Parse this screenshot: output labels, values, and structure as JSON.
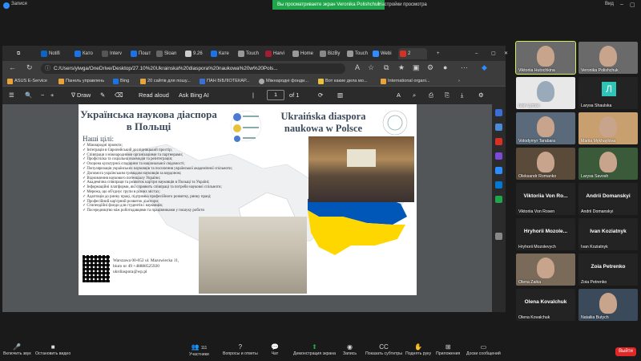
{
  "top": {
    "recording_label": "Запися",
    "share_banner": "Вы просматриваете экран Veronika Polishchuk",
    "share_settings": "Настройки просмотра",
    "view_label": "Вид"
  },
  "browser": {
    "tabs": [
      "Notifi",
      "Катo",
      "Interv",
      "Пошт",
      "Sloan",
      "9.26",
      "Катe",
      "Touch",
      "Harvi",
      "Home",
      "BizBy",
      "Touch",
      "Webi",
      "2"
    ],
    "url": "C:/Users/yiwga/OneDrive/Desktop/27.10%20Ukrainska%20diaspora%20naukowa%20w%20Pols...",
    "favorites": [
      "ASUS E-Service",
      "Панель управлень",
      "Bing",
      "20 сайтів для пошу...",
      "ПАН БІБЛІОТЕКАР...",
      "Міжнародні фонди...",
      "Вот какие дела мо...",
      "International organi..."
    ],
    "pdf": {
      "draw": "Draw",
      "read_aloud": "Read aloud",
      "ask_bing": "Ask Bing AI",
      "page": "1",
      "of": "of 1"
    }
  },
  "slide": {
    "title_ua": "Українська наукова діаспора в Польщі",
    "title_pl": "Ukraińska diaspora naukowa w Polsce",
    "goals_title": "Наші цілі:",
    "goals": [
      "Міжнародні проекти;",
      "Інтеграція в Європейський дослідницький простір;",
      "Співпраця з міжнародними організаціями та партнерами;",
      "Профспілка та соціальна взаємодія та реінтеграція;",
      "Охорона культурної спадщини та національної свідомості;",
      "Популяризація українських науковців та посилення української академічної спільноти;",
      "Допомога українським громадам науковців за кордоном;",
      "Відновлення наукового потенціалу України;",
      "Академічна співпраця та розвиток кар'єри науковців в Польщі та Україні;",
      "Інформаційні платформи, які сприяють співпраці та потреби наукової спільноти;",
      "Мережа, що об'єднує групи в різних містах;",
      "Адаптація до ринку праці, підтримка професійного розвитку, ринку праці;",
      "Професійний кар'єрний розвиток діаспори;",
      "Стипендійні фонди для студентів і науковців;",
      "Посередництво між роботодавцями та працівниками у пошуку роботи"
    ],
    "address": [
      "Warszawa 00-052 ul. Mazowiecka 11,",
      "biuro nr 49 +48888525920",
      "ukrdiaspora@wp.pl"
    ]
  },
  "participants": [
    {
      "name": "Viktoriia Hutochkina",
      "type": "camera",
      "highlight": true
    },
    {
      "name": "Veronika Polishchuk",
      "type": "camera"
    },
    {
      "name": "Ivan Lyman",
      "type": "camera"
    },
    {
      "name": "Larysa Shaulska",
      "type": "initial",
      "initial": "Л"
    },
    {
      "name": "Volodymyr Tarabara",
      "type": "camera"
    },
    {
      "name": "Mariia Mykhaylova",
      "type": "camera"
    },
    {
      "name": "Oleksandr Romanko",
      "type": "camera"
    },
    {
      "name": "Larysa Savosh",
      "type": "camera"
    },
    {
      "name": "Viktoriia Von Rosen",
      "type": "name",
      "big": "Viktoriia Von Ro..."
    },
    {
      "name": "Andrii Domanskyi",
      "type": "name",
      "big": "Andrii Domanskyi"
    },
    {
      "name": "Hryhorii Mozolevych",
      "type": "name",
      "big": "Hryhorii Mozole..."
    },
    {
      "name": "Ivan Koziatnyk",
      "type": "name",
      "big": "Ivan Koziatnyk"
    },
    {
      "name": "Olena Zaika",
      "type": "camera"
    },
    {
      "name": "Zoia Petrenko",
      "type": "name",
      "big": "Zoia Petrenko"
    },
    {
      "name": "Olena Kovalchuk",
      "type": "name",
      "big": "Olena Kovalchuk"
    },
    {
      "name": "Nataliia Butych",
      "type": "camera"
    }
  ],
  "bottom": {
    "unmute": "Включить звук",
    "stop_video": "Остановить видео",
    "participants": "Участники",
    "participants_count": "111",
    "qa": "Вопросы и ответы",
    "chat": "Чат",
    "share_screen": "Демонстрация экрана",
    "record": "Запись",
    "subtitles": "Показать субтитры",
    "raise_hand": "Поднять руку",
    "apps": "Приложения",
    "whiteboards": "Доски сообщений",
    "leave": "Выйти"
  }
}
